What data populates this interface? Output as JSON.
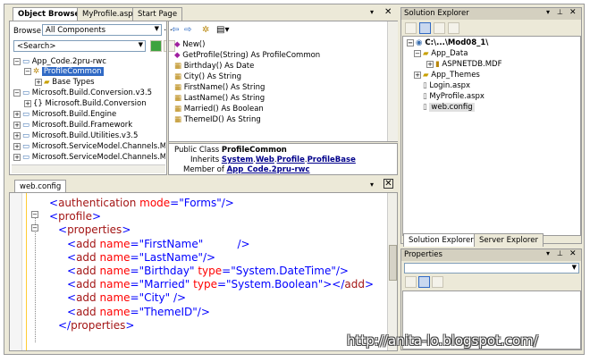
{
  "object_browser": {
    "tabs": [
      "Object Browser",
      "MyProfile.aspx",
      "Start Page"
    ],
    "close_glyphs": [
      "▾",
      "✕"
    ],
    "browse_label": "Browse:",
    "browse_value": "All Components",
    "search_placeholder": "<Search>",
    "tree": [
      {
        "label": "App_Code.2pru-rwc",
        "expanded": true
      },
      {
        "label": "ProfileCommon",
        "selected": true
      },
      {
        "label": "Base Types"
      },
      {
        "label": "Microsoft.Build.Conversion.v3.5"
      },
      {
        "label": "Microsoft.Build.Conversion"
      },
      {
        "label": "Microsoft.Build.Engine"
      },
      {
        "label": "Microsoft.Build.Framework"
      },
      {
        "label": "Microsoft.Build.Utilities.v3.5"
      },
      {
        "label": "Microsoft.ServiceModel.Channels.Mail"
      },
      {
        "label": "Microsoft.ServiceModel.Channels.Mail.E"
      }
    ],
    "members": [
      "New()",
      "GetProfile(String) As ProfileCommon",
      "Birthday() As Date",
      "City() As String",
      "FirstName() As String",
      "LastName() As String",
      "Married() As Boolean",
      "ThemeID() As String"
    ],
    "desc": {
      "line1_prefix": "Public Class ",
      "line1_name": "ProfileCommon",
      "inherits_label": "Inherits ",
      "inherits_parts": [
        "System",
        "Web",
        "Profile",
        "ProfileBase"
      ],
      "member_of_label": "Member of ",
      "member_of_value": "App_Code.2pru-rwc"
    }
  },
  "editor": {
    "tab": "web.config",
    "lines": [
      {
        "indent": 0,
        "parts": [
          [
            "b",
            "<"
          ],
          [
            "t",
            "authentication"
          ],
          [
            "s",
            " "
          ],
          [
            "a",
            "mode"
          ],
          [
            "b",
            "="
          ],
          [
            "v",
            "\"Forms\""
          ],
          [
            "b",
            "/>"
          ]
        ]
      },
      {
        "indent": 0,
        "parts": [
          [
            "b",
            "<"
          ],
          [
            "t",
            "profile"
          ],
          [
            "b",
            ">"
          ]
        ]
      },
      {
        "indent": 1,
        "parts": [
          [
            "b",
            "<"
          ],
          [
            "t",
            "properties"
          ],
          [
            "b",
            ">"
          ]
        ]
      },
      {
        "indent": 2,
        "parts": [
          [
            "b",
            "<"
          ],
          [
            "t",
            "add"
          ],
          [
            "s",
            " "
          ],
          [
            "a",
            "name"
          ],
          [
            "b",
            "="
          ],
          [
            "v",
            "\"FirstName\""
          ],
          [
            "s",
            "          "
          ],
          [
            "b",
            "/>"
          ]
        ]
      },
      {
        "indent": 2,
        "parts": [
          [
            "b",
            "<"
          ],
          [
            "t",
            "add"
          ],
          [
            "s",
            " "
          ],
          [
            "a",
            "name"
          ],
          [
            "b",
            "="
          ],
          [
            "v",
            "\"LastName\""
          ],
          [
            "b",
            "/>"
          ]
        ]
      },
      {
        "indent": 2,
        "parts": [
          [
            "b",
            "<"
          ],
          [
            "t",
            "add"
          ],
          [
            "s",
            " "
          ],
          [
            "a",
            "name"
          ],
          [
            "b",
            "="
          ],
          [
            "v",
            "\"Birthday\""
          ],
          [
            "s",
            " "
          ],
          [
            "a",
            "type"
          ],
          [
            "b",
            "="
          ],
          [
            "v",
            "\"System.DateTime\""
          ],
          [
            "b",
            "/>"
          ]
        ]
      },
      {
        "indent": 2,
        "parts": [
          [
            "b",
            "<"
          ],
          [
            "t",
            "add"
          ],
          [
            "s",
            " "
          ],
          [
            "a",
            "name"
          ],
          [
            "b",
            "="
          ],
          [
            "v",
            "\"Married\""
          ],
          [
            "s",
            " "
          ],
          [
            "a",
            "type"
          ],
          [
            "b",
            "="
          ],
          [
            "v",
            "\"System.Boolean\""
          ],
          [
            "b",
            "></"
          ],
          [
            "t",
            "add"
          ],
          [
            "b",
            ">"
          ]
        ]
      },
      {
        "indent": 2,
        "parts": [
          [
            "b",
            "<"
          ],
          [
            "t",
            "add"
          ],
          [
            "s",
            " "
          ],
          [
            "a",
            "name"
          ],
          [
            "b",
            "="
          ],
          [
            "v",
            "\"City\""
          ],
          [
            "s",
            " "
          ],
          [
            "b",
            "/>"
          ]
        ]
      },
      {
        "indent": 2,
        "parts": [
          [
            "b",
            "<"
          ],
          [
            "t",
            "add"
          ],
          [
            "s",
            " "
          ],
          [
            "a",
            "name"
          ],
          [
            "b",
            "="
          ],
          [
            "v",
            "\"ThemeID\""
          ],
          [
            "b",
            "/>"
          ]
        ]
      },
      {
        "indent": 1,
        "parts": [
          [
            "b",
            "</"
          ],
          [
            "t",
            "properties"
          ],
          [
            "b",
            ">"
          ]
        ]
      }
    ]
  },
  "solution_explorer": {
    "title": "Solution Explorer",
    "path": "C:\\...\\Mod08_1\\",
    "items": [
      {
        "label": "App_Data",
        "depth": 1
      },
      {
        "label": "ASPNETDB.MDF",
        "depth": 2
      },
      {
        "label": "App_Themes",
        "depth": 1
      },
      {
        "label": "Login.aspx",
        "depth": 1
      },
      {
        "label": "MyProfile.aspx",
        "depth": 1
      },
      {
        "label": "web.config",
        "depth": 1,
        "selected": true
      }
    ],
    "tabs": [
      "Solution Explorer",
      "Server Explorer"
    ]
  },
  "properties": {
    "title": "Properties"
  },
  "watermark": "http://anita-lo.blogspot.com/",
  "colors": {
    "selection": "#316AC5",
    "link": "#00008B"
  }
}
